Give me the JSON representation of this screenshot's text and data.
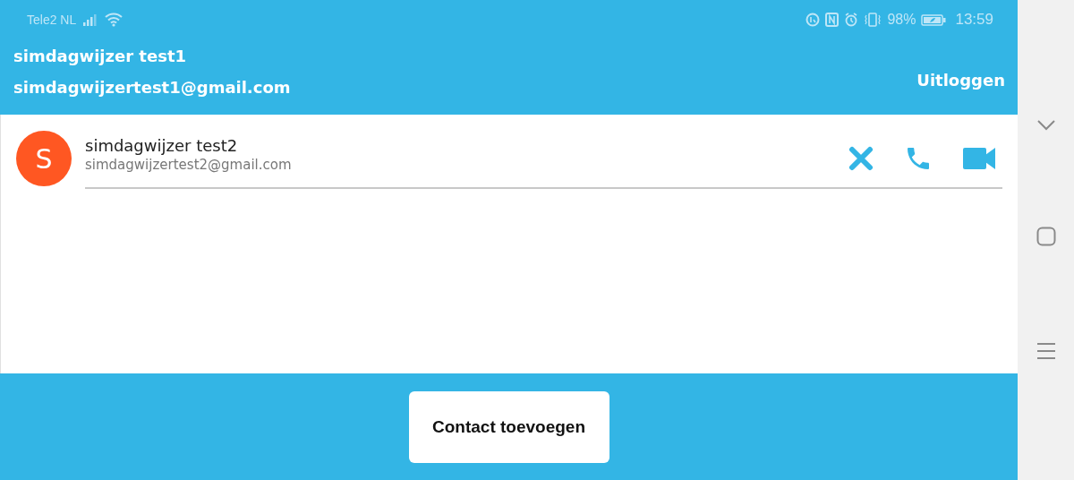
{
  "status_bar": {
    "carrier": "Tele2 NL",
    "battery": "98%",
    "time": "13:59"
  },
  "header": {
    "name": "simdagwijzer test1",
    "email": "simdagwijzertest1@gmail.com",
    "logout": "Uitloggen"
  },
  "contacts": [
    {
      "initial": "S",
      "color": "#ff5722",
      "name": "simdagwijzer test2",
      "email": "simdagwijzertest2@gmail.com"
    }
  ],
  "add_button": "Contact toevoegen"
}
